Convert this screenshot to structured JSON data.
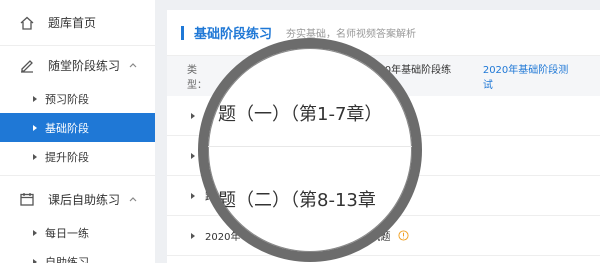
{
  "sidebar": {
    "home": {
      "label": "题库首页",
      "icon": "home-icon"
    },
    "groups": [
      {
        "label": "随堂阶段练习",
        "icon": "pen-icon",
        "items": [
          {
            "label": "预习阶段",
            "active": false
          },
          {
            "label": "基础阶段",
            "active": true
          },
          {
            "label": "提升阶段",
            "active": false
          }
        ]
      },
      {
        "label": "课后自助练习",
        "icon": "calendar-icon",
        "items": [
          {
            "label": "每日一练",
            "active": false
          },
          {
            "label": "自助练习",
            "active": false
          }
        ]
      }
    ]
  },
  "main": {
    "title": "基础阶段练习",
    "subtitle": "夯实基础，名师视频答案解析",
    "filter": {
      "label": "类型：",
      "options": [
        {
          "label": "2020年基础阶段练习",
          "active": false
        },
        {
          "label": "2020年基础阶段测试",
          "active": true
        }
      ]
    },
    "rows": [
      {
        "text": ""
      },
      {
        "text": ""
      },
      {
        "text": "跨章"
      },
      {
        "text": "2020年《中级会计实务》基础阶段测试题"
      }
    ],
    "magnifier": {
      "line1": "题（一）（第1-7章）",
      "line2": "题（二）（第8-13章"
    }
  },
  "colors": {
    "accent": "#1f78d6",
    "info": "#f0a020"
  }
}
